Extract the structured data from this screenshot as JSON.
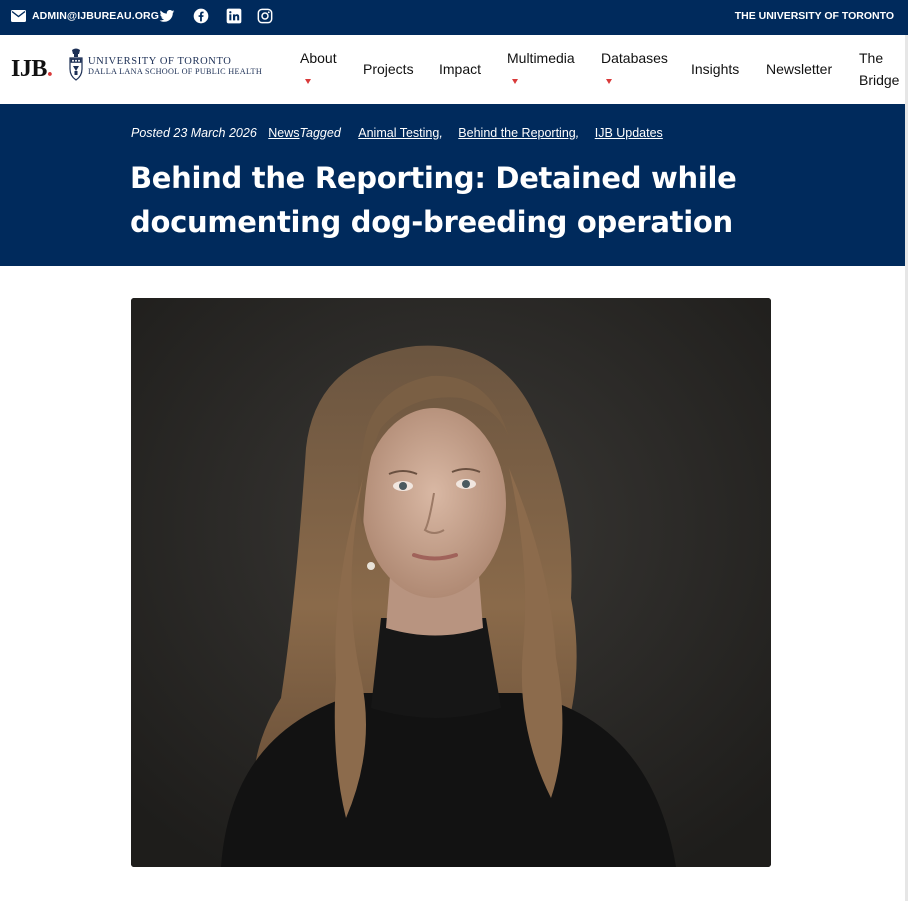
{
  "topbar": {
    "email": "ADMIN@IJBUREAU.ORG",
    "social": [
      "twitter-icon",
      "facebook-icon",
      "linkedin-icon",
      "instagram-icon"
    ],
    "university_link": "THE UNIVERSITY OF TORONTO"
  },
  "header": {
    "logo_ijb": "IJB",
    "logo_dot": ".",
    "uoft_line1": "UNIVERSITY OF TORONTO",
    "uoft_line2": "DALLA LANA SCHOOL OF PUBLIC HEALTH",
    "nav": {
      "about": "About",
      "projects": "Projects",
      "impact": "Impact",
      "multimedia": "Multimedia",
      "databases": "Databases",
      "insights": "Insights",
      "newsletter": "Newsletter",
      "the": "The",
      "bridge": "Bridge"
    }
  },
  "post": {
    "posted": "Posted 23 March 2026",
    "category": "News",
    "tagged": "Tagged",
    "tags": [
      "Animal Testing",
      "Behind the Reporting",
      "IJB Updates"
    ],
    "title_line1": "Behind the Reporting: Detained while",
    "title_line2": "documenting dog-breeding operation"
  },
  "colors": {
    "navy": "#002a5c",
    "accent_red": "#d93a3a",
    "white": "#ffffff"
  }
}
